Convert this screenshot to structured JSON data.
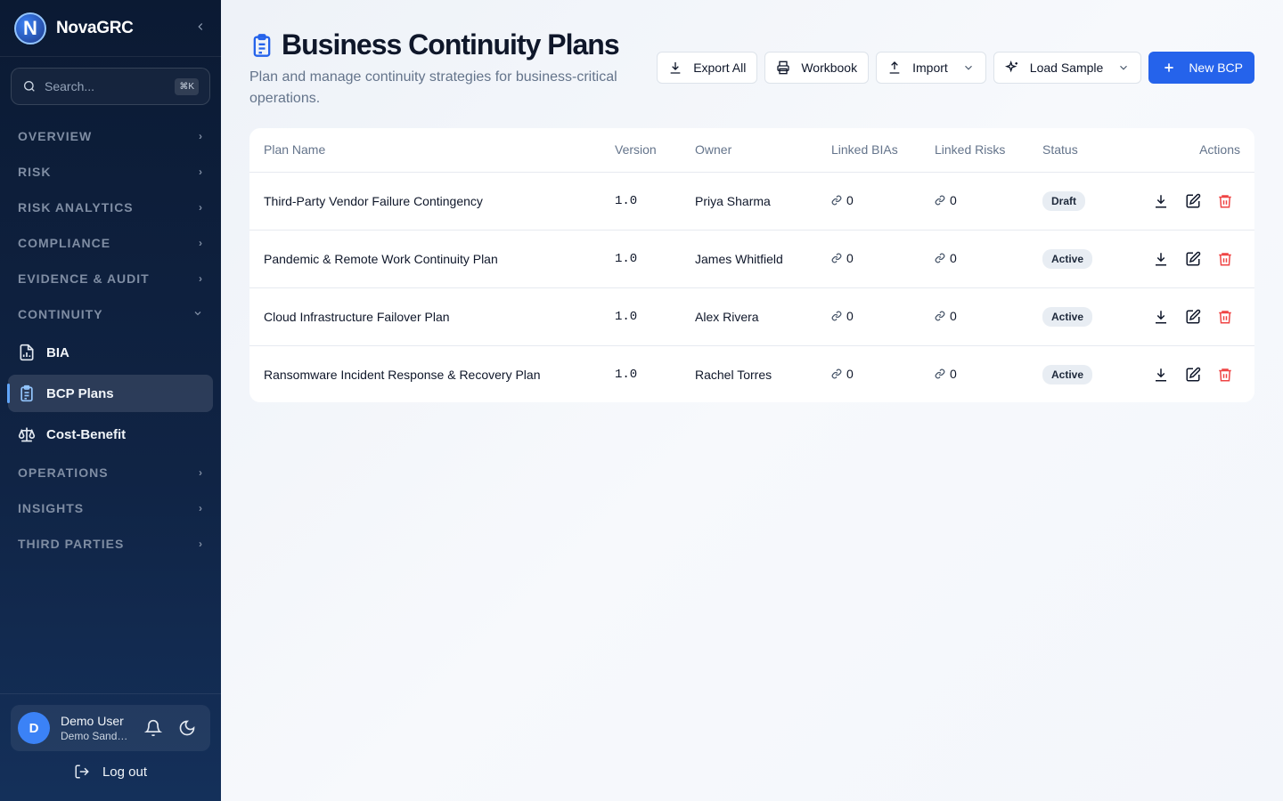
{
  "brand": {
    "name": "NovaGRC",
    "logo_letter": "N"
  },
  "search": {
    "placeholder": "Search...",
    "shortcut": "⌘K"
  },
  "nav": {
    "overview": "OVERVIEW",
    "risk": "RISK",
    "risk_analytics": "RISK ANALYTICS",
    "compliance": "COMPLIANCE",
    "evidence_audit": "EVIDENCE & AUDIT",
    "continuity": "CONTINUITY",
    "continuity_items": {
      "bia": "BIA",
      "bcp_plans": "BCP Plans",
      "cost_benefit": "Cost-Benefit"
    },
    "operations": "OPERATIONS",
    "insights": "INSIGHTS",
    "third_parties": "THIRD PARTIES"
  },
  "user": {
    "initial": "D",
    "name": "Demo User",
    "org": "Demo Sandbox"
  },
  "logout": "Log out",
  "page": {
    "title": "Business Continuity Plans",
    "subtitle": "Plan and manage continuity strategies for business-critical operations."
  },
  "actions": {
    "export_all": "Export All",
    "workbook": "Workbook",
    "import": "Import",
    "load_sample": "Load Sample",
    "new_bcp": "New BCP"
  },
  "table": {
    "headers": {
      "name": "Plan Name",
      "version": "Version",
      "owner": "Owner",
      "bias": "Linked BIAs",
      "risks": "Linked Risks",
      "status": "Status",
      "actions": "Actions"
    },
    "rows": [
      {
        "name": "Third-Party Vendor Failure Contingency",
        "version": "1.0",
        "owner": "Priya Sharma",
        "bias": "0",
        "risks": "0",
        "status": "Draft"
      },
      {
        "name": "Pandemic & Remote Work Continuity Plan",
        "version": "1.0",
        "owner": "James Whitfield",
        "bias": "0",
        "risks": "0",
        "status": "Active"
      },
      {
        "name": "Cloud Infrastructure Failover Plan",
        "version": "1.0",
        "owner": "Alex Rivera",
        "bias": "0",
        "risks": "0",
        "status": "Active"
      },
      {
        "name": "Ransomware Incident Response & Recovery Plan",
        "version": "1.0",
        "owner": "Rachel Torres",
        "bias": "0",
        "risks": "0",
        "status": "Active"
      }
    ]
  },
  "colors": {
    "primary": "#2563eb",
    "sidebar": "#0b1a33",
    "danger": "#ef4444"
  }
}
